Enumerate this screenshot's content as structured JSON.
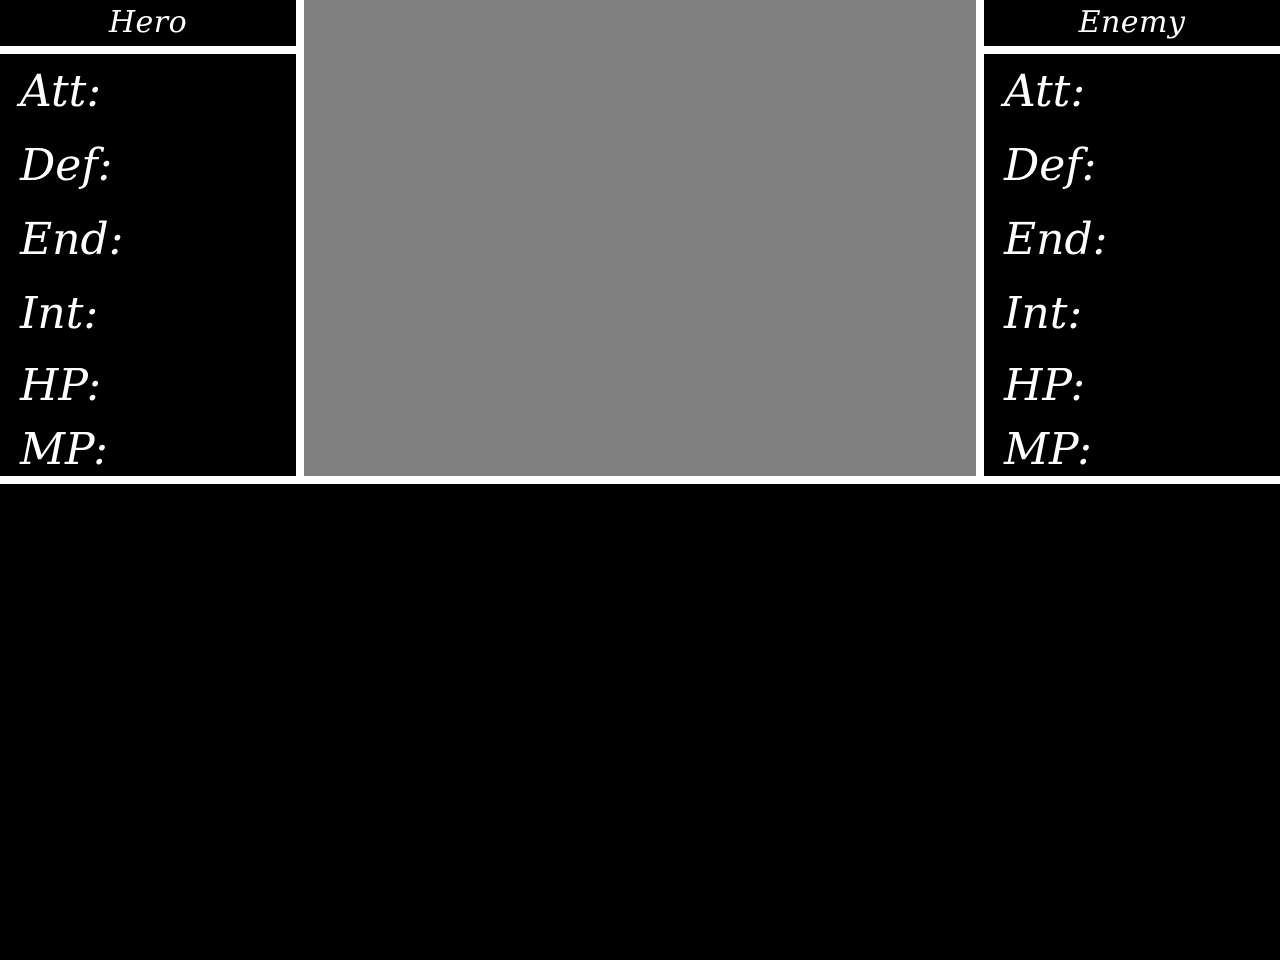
{
  "colors": {
    "background": "#000000",
    "divider": "#ffffff",
    "battle_view": "#808080",
    "text": "#ffffff"
  },
  "hero": {
    "title": "Hero",
    "stats": [
      "Att:",
      "Def:",
      "End:",
      "Int:",
      "HP:",
      "MP:"
    ]
  },
  "enemy": {
    "title": "Enemy",
    "stats": [
      "Att:",
      "Def:",
      "End:",
      "Int:",
      "HP:",
      "MP:"
    ]
  }
}
